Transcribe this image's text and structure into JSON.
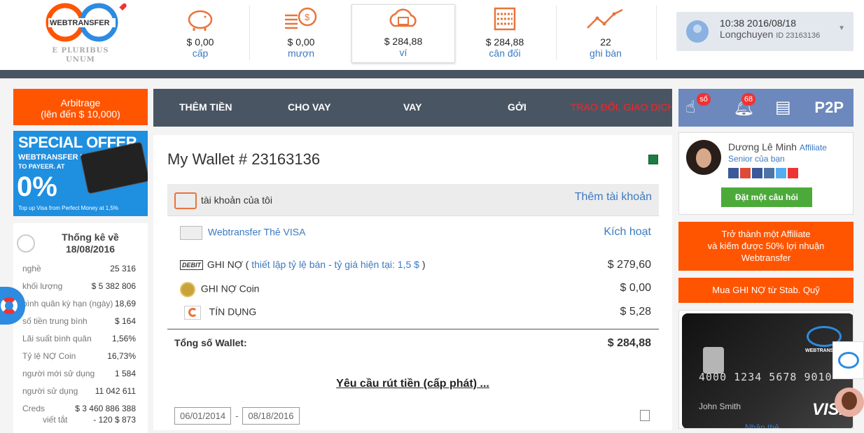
{
  "logo": {
    "name": "WEBTRANSFER",
    "motto_line1": "E PLURIBUS",
    "motto_line2": "UNUM"
  },
  "stats_bar": [
    {
      "icon": "piggy-bank-icon",
      "value": "$ 0,00",
      "label": "cấp"
    },
    {
      "icon": "coins-icon",
      "value": "$ 0,00",
      "label": "mượn"
    },
    {
      "icon": "cloud-wallet-icon",
      "value": "$ 284,88",
      "label": "ví"
    },
    {
      "icon": "abacus-icon",
      "value": "$ 284,88",
      "label": "cân đối"
    },
    {
      "icon": "trend-line-icon",
      "value": "22",
      "label": "ghi bàn"
    }
  ],
  "user_box": {
    "datetime": "10:38 2016/08/18",
    "name": "Longchuyen",
    "id_text": "ID 23163136"
  },
  "left": {
    "arbitrage_line1": "Arbitrage",
    "arbitrage_line2": "(lên đến $ 10,000)",
    "offer": {
      "headline": "SPECIAL OFFER",
      "line1": "WEBTRANSFER VISA CARD",
      "line2": "TO PAYEER. AT",
      "percent": "0%",
      "footer": "Top up Visa from Perfect Money at 1,5%"
    },
    "stats_title_line1": "Thống kê về",
    "stats_title_line2": "18/08/2016",
    "stats": [
      {
        "k": "nghề",
        "v": "25 316"
      },
      {
        "k": "khối lượng",
        "v": "$ 5 382 806"
      },
      {
        "k": "bình quân kỳ hạn (ngày)",
        "v": "18,69"
      },
      {
        "k": "số tiền trung bình",
        "v": "$ 164"
      },
      {
        "k": "Lãi suất bình quân",
        "v": "1,56%"
      },
      {
        "k": "Tỷ lệ NỢ Coin",
        "v": "16,73%"
      },
      {
        "k": "người mới sử dụng",
        "v": "1 584"
      },
      {
        "k": "người sử dụng",
        "v": "11 042 611"
      },
      {
        "k": "Creds",
        "v": "$ 3 460 886 388"
      },
      {
        "k": "viết tắt",
        "v": "- 120 $ 873"
      }
    ]
  },
  "nav": {
    "add_money": "THÊM TIỀN",
    "lend": "CHO VAY",
    "borrow": "VAY",
    "send": "GỞI",
    "exchange": "TRAO ĐỔI, GIAO DỊCH"
  },
  "wallet": {
    "title": "My Wallet # 23163136",
    "my_account": "tài khoản của tôi",
    "add_account": "Thêm tài khoản",
    "visa_card": "Webtransfer Thẻ VISA",
    "activate": "Kích hoạt",
    "debit_badge": "DEBIT",
    "debit_label": "GHI NỢ (",
    "debit_link": "thiết lập tỷ lệ bán - tỷ giá hiện tại: 1,5 $",
    "debit_close": ")",
    "debit_value": "$ 279,60",
    "coin_label": "GHI NỢ Coin",
    "coin_value": "$ 0,00",
    "credit_label": "TÍN DỤNG",
    "credit_value": "$ 5,28",
    "total_label": "Tổng số Wallet:",
    "total_value": "$ 284,88",
    "withdraw": "Yêu cầu rút tiền (cấp phát) ...",
    "date_from": "06/01/2014",
    "date_sep": "-",
    "date_to": "08/18/2016"
  },
  "right": {
    "badge1": "số",
    "badge2": "68",
    "p2p": "P2P",
    "advisor_name": "Dương Lê Minh",
    "advisor_role": "Affiliate",
    "advisor_sub": "Senior của bạn",
    "ask_button": "Đặt một câu hỏi",
    "affiliate_line1": "Trở thành một Affiliate",
    "affiliate_line2": "và kiếm được 50% lợi nhuận",
    "affiliate_line3": "Webtransfer",
    "buy_debit": "Mua GHI NỢ từ Stab. Quỹ",
    "card_number": "4000 1234 5678 9010",
    "card_name": "John Smith",
    "card_brand": "VISA",
    "card_issuer": "WEBTRANSFER",
    "card_below": "Nhận thẻ"
  },
  "colors": {
    "accent": "#ff5500",
    "nav": "#4a5563",
    "link": "#3b7ac1",
    "right_icons": "#6c88bd",
    "green": "#4caa3a"
  }
}
